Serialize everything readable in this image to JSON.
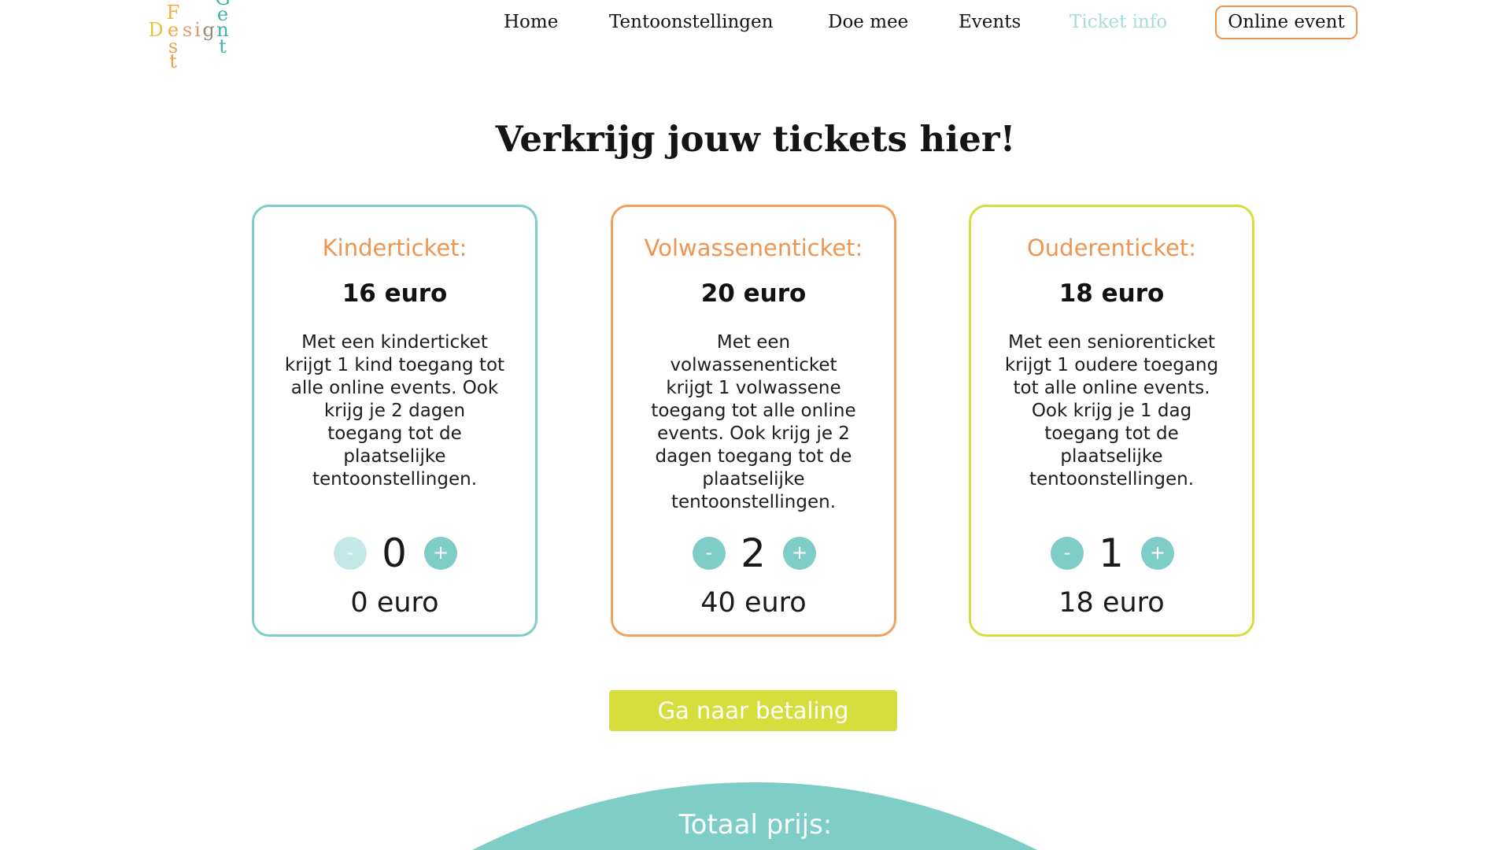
{
  "theme": {
    "teal": "#7ecdc7",
    "orange": "#ef9552",
    "lime": "#d4df3e",
    "nav_active": "#a7dcd9",
    "stepper_disabled": "#c4e8e5",
    "text": "#141414"
  },
  "logo": {
    "fest": "Fest",
    "design": "Design",
    "gent": "Gent"
  },
  "nav": {
    "items": [
      {
        "label": "Home",
        "active": false
      },
      {
        "label": "Tentoonstellingen",
        "active": false
      },
      {
        "label": "Doe mee",
        "active": false
      },
      {
        "label": "Events",
        "active": false
      },
      {
        "label": "Ticket info",
        "active": true
      }
    ],
    "cta_label": "Online event"
  },
  "page_title": "Verkrijg jouw tickets hier!",
  "tickets": [
    {
      "name": "Kinderticket:",
      "price": "16 euro",
      "border_color": "#7ecdc7",
      "description_lines": [
        "Met een kinderticket",
        "krijgt 1 kind toegang tot",
        "alle online events. Ook",
        "krijg je 2 dagen",
        "toegang tot de",
        "plaatselijke",
        "tentoonstellingen."
      ],
      "minus_label": "-",
      "plus_label": "+",
      "minus_enabled": false,
      "quantity": "0",
      "subtotal": "0 euro"
    },
    {
      "name": "Volwassenenticket:",
      "price": "20 euro",
      "border_color": "#f2a15c",
      "description_lines": [
        "Met een",
        "volwassenenticket",
        "krijgt 1 volwassene",
        "toegang tot alle online",
        "events. Ook krijg je 2",
        "dagen toegang tot de",
        "plaatselijke",
        "tentoonstellingen."
      ],
      "minus_label": "-",
      "plus_label": "+",
      "minus_enabled": true,
      "quantity": "2",
      "subtotal": "40 euro"
    },
    {
      "name": "Ouderenticket:",
      "price": "18 euro",
      "border_color": "#d4df3e",
      "description_lines": [
        "Met een seniorenticket",
        "krijgt 1 oudere toegang",
        "tot alle online events.",
        "Ook krijg je 1 dag",
        "toegang tot de",
        "plaatselijke",
        "tentoonstellingen."
      ],
      "minus_label": "-",
      "plus_label": "+",
      "minus_enabled": true,
      "quantity": "1",
      "subtotal": "18 euro"
    }
  ],
  "checkout_label": "Ga naar betaling",
  "total_label": "Totaal prijs:"
}
